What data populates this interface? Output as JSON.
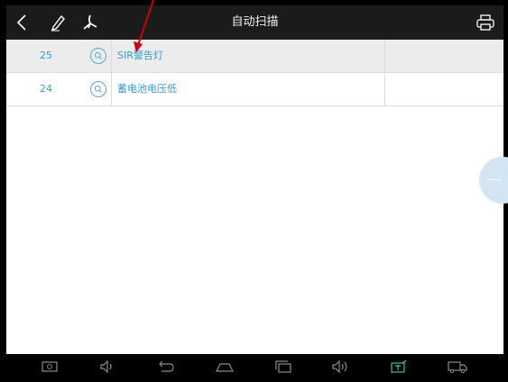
{
  "header": {
    "title": "自动扫描",
    "back_icon": "chevron-left-icon",
    "edit_icon": "pencil-icon",
    "pdf_icon": "pdf-icon",
    "print_icon": "printer-icon"
  },
  "dtc_list": [
    {
      "code": "25",
      "description": "SIR警告灯",
      "selected": true
    },
    {
      "code": "24",
      "description": "蓄电池电压低",
      "selected": false
    }
  ],
  "navbar": {
    "items": [
      "screenshot-icon",
      "volume-down-icon",
      "back-icon",
      "home-icon",
      "recent-apps-icon",
      "volume-up-icon",
      "app-launcher-icon",
      "truck-icon"
    ]
  },
  "colors": {
    "accent": "#3a9bd5",
    "header_bg": "#1b1b1b",
    "selected_row": "#ececec",
    "annotation": "#cc0000"
  }
}
